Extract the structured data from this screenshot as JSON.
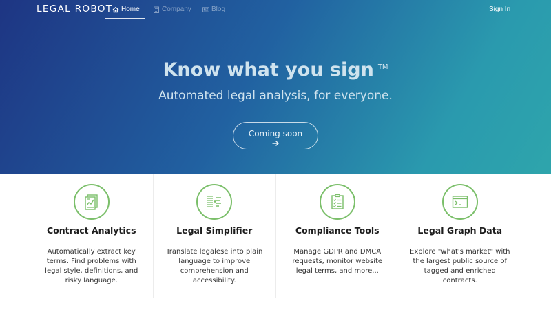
{
  "nav": {
    "brand": "LEGAL ROBOT",
    "items": [
      {
        "label": "Home",
        "icon": "home-icon",
        "active": true
      },
      {
        "label": "Company",
        "icon": "document-icon",
        "active": false
      },
      {
        "label": "Blog",
        "icon": "newspaper-icon",
        "active": false
      }
    ],
    "sign_in": "Sign In"
  },
  "hero": {
    "title": "Know what you sign",
    "trademark": "TM",
    "subtitle": "Automated legal analysis, for everyone.",
    "cta_label": "Coming soon",
    "cta_icon": "arrow-right-icon"
  },
  "features": [
    {
      "title": "Contract Analytics",
      "icon": "contract-analytics-icon",
      "description": "Automatically extract key terms. Find problems with legal style, definitions, and risky language."
    },
    {
      "title": "Legal Simplifier",
      "icon": "simplifier-icon",
      "description": "Translate legalese into plain language to improve comprehension and accessibility."
    },
    {
      "title": "Compliance Tools",
      "icon": "checklist-icon",
      "description": "Manage GDPR and DMCA requests, monitor website legal terms, and more..."
    },
    {
      "title": "Legal Graph Data",
      "icon": "terminal-icon",
      "description": "Explore \"what's market\" with the largest public source of tagged and enriched contracts."
    }
  ],
  "colors": {
    "accent_green": "#7bbf6a",
    "hero_start": "#1e3583",
    "hero_end": "#2ea5ac"
  }
}
